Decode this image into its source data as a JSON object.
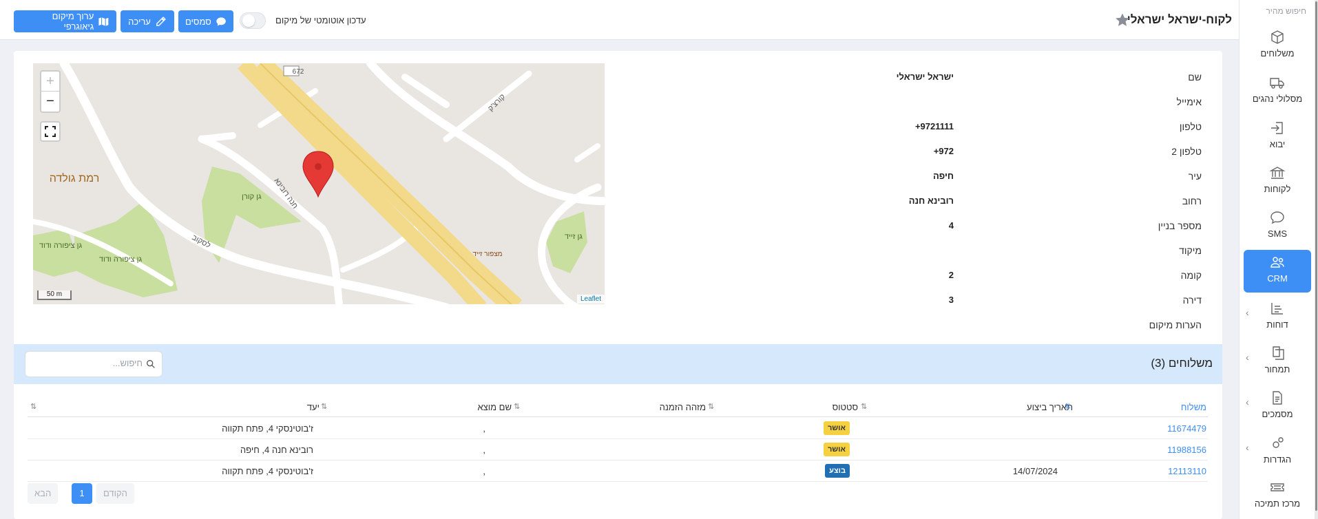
{
  "header": {
    "title": "לקוח-ישראל ישראלי",
    "auto_update_label": "עדכון אוטומטי של מיקום",
    "auto_update_on": false,
    "buttons": {
      "sms": "סמסים",
      "edit": "עריכה",
      "geo": "ערוך מיקום גיאוגרפי"
    }
  },
  "sidebar": {
    "quick_search": "חיפוש מהיר",
    "items": [
      {
        "label": "משלוחים",
        "icon": "box-icon",
        "active": false,
        "chevron": false
      },
      {
        "label": "מסלולי נהגים",
        "icon": "truck-icon",
        "active": false,
        "chevron": false
      },
      {
        "label": "יבוא",
        "icon": "import-icon",
        "active": false,
        "chevron": false
      },
      {
        "label": "לקוחות",
        "icon": "bank-icon",
        "active": false,
        "chevron": false
      },
      {
        "label": "SMS",
        "icon": "chat-bubble-icon",
        "active": false,
        "chevron": false
      },
      {
        "label": "CRM",
        "icon": "users-icon",
        "active": true,
        "chevron": false
      },
      {
        "label": "דוחות",
        "icon": "report-icon",
        "active": false,
        "chevron": true
      },
      {
        "label": "תמחור",
        "icon": "pricing-icon",
        "active": false,
        "chevron": true
      },
      {
        "label": "מסמכים",
        "icon": "document-icon",
        "active": false,
        "chevron": true
      },
      {
        "label": "הגדרות",
        "icon": "settings-icon",
        "active": false,
        "chevron": true
      },
      {
        "label": "מרכז תמיכה",
        "icon": "ticket-icon",
        "active": false,
        "chevron": false
      }
    ]
  },
  "details": [
    {
      "key": "שם",
      "value": "ישראל ישראלי"
    },
    {
      "key": "אימייל",
      "value": ""
    },
    {
      "key": "טלפון",
      "value": "9721111+"
    },
    {
      "key": "טלפון 2",
      "value": "972+"
    },
    {
      "key": "עיר",
      "value": "חיפה"
    },
    {
      "key": "רחוב",
      "value": "רובינא חנה"
    },
    {
      "key": "מספר בניין",
      "value": "4"
    },
    {
      "key": "מיקוד",
      "value": ""
    },
    {
      "key": "קומה",
      "value": "2"
    },
    {
      "key": "דירה",
      "value": "3"
    },
    {
      "key": "הערות מיקום",
      "value": ""
    }
  ],
  "map": {
    "zoom_in": "+",
    "zoom_out": "−",
    "scale": "50 m",
    "attribution": "Leaflet",
    "labels": {
      "street1": "קורצ'ק",
      "street2": "חנה רובינא",
      "street3": "לסקוב",
      "park1": "גן קורן",
      "park2": "גן ציפורה ודוד",
      "park3": "גן ציפורה ודוד",
      "park4": "גן זייד",
      "viewpoint": "מצפור זייד",
      "neighborhood": "רמת גולדה",
      "road_number": "672"
    }
  },
  "shipments": {
    "title": "משלוחים (3)",
    "search_placeholder": "חיפוש...",
    "columns": {
      "shipment": "משלוח",
      "date": "תאריך ביצוע",
      "status": "סטטוס",
      "order_id": "מזהה הזמנה",
      "origin": "שם מוצא",
      "destination": "יעד"
    },
    "rows": [
      {
        "shipment": "11674479",
        "date": "",
        "status": "אושר",
        "status_color": "#f5d142",
        "order_id": "",
        "origin": ",",
        "destination": "ז'בוטינסקי 4, פתח תקווה"
      },
      {
        "shipment": "11988156",
        "date": "",
        "status": "אושר",
        "status_color": "#f5d142",
        "order_id": "",
        "origin": ",",
        "destination": "רובינא חנה 4, חיפה"
      },
      {
        "shipment": "12113110",
        "date": "14/07/2024",
        "status": "בוצע",
        "status_color": "#1f6fb2",
        "order_id": "",
        "origin": ",",
        "destination": "ז'בוטינסקי 4, פתח תקווה"
      }
    ],
    "pager": {
      "prev": "הקודם",
      "current": "1",
      "next": "הבא"
    }
  },
  "colors": {
    "accent": "#3d8ef5",
    "band": "#d6e8fb",
    "marker": "#e53935"
  }
}
